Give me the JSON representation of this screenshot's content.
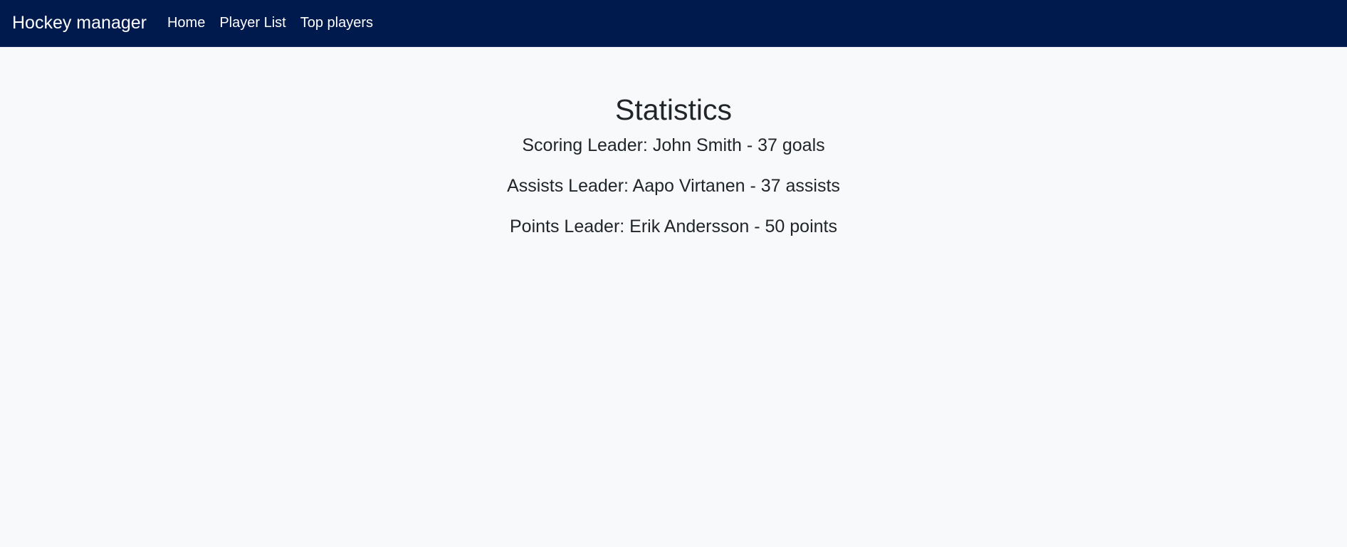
{
  "navbar": {
    "brand": "Hockey manager",
    "links": [
      {
        "label": "Home"
      },
      {
        "label": "Player List"
      },
      {
        "label": "Top players"
      }
    ]
  },
  "main": {
    "title": "Statistics",
    "stats": [
      {
        "text": "Scoring Leader: John Smith - 37 goals"
      },
      {
        "text": "Assists Leader: Aapo Virtanen - 37 assists"
      },
      {
        "text": "Points Leader: Erik Andersson - 50 points"
      }
    ]
  },
  "colors": {
    "navbar_bg": "#001a4d",
    "page_bg": "#f8f9fa",
    "text": "#212529",
    "nav_text": "#ffffff"
  }
}
